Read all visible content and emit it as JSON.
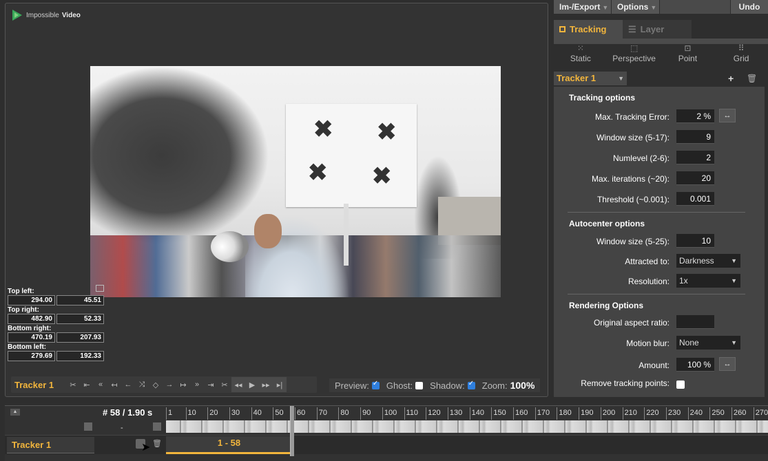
{
  "logo": {
    "brand_light": "Impossible",
    "brand_bold": "Video"
  },
  "video": {
    "marks": [
      "✖",
      "✖",
      "✖",
      "✖"
    ]
  },
  "corners": [
    {
      "label": "Top left:",
      "x": "294.00",
      "y": "45.51"
    },
    {
      "label": "Top right:",
      "x": "482.90",
      "y": "52.33"
    },
    {
      "label": "Bottom right:",
      "x": "470.19",
      "y": "207.93"
    },
    {
      "label": "Bottom left:",
      "x": "279.69",
      "y": "192.33"
    }
  ],
  "viewer_bar": {
    "tracker_name": "Tracker 1",
    "icons": [
      "scissors-icon",
      "first-frame-icon",
      "step-back-icon",
      "key-back-icon",
      "back-icon",
      "shuffle-icon",
      "keyframe-icon",
      "forward-icon",
      "key-forward-icon",
      "step-forward-icon",
      "last-frame-icon",
      "cut-icon"
    ],
    "preview_label": "Preview:",
    "ghost_label": "Ghost:",
    "shadow_label": "Shadow:",
    "zoom_label": "Zoom:",
    "zoom_value": "100%",
    "preview_on": true,
    "ghost_on": false,
    "shadow_on": true
  },
  "menu": {
    "import_export": "Im-/Export",
    "options": "Options",
    "undo": "Undo"
  },
  "tabs": {
    "tracking": "Tracking",
    "layer": "Layer"
  },
  "modes": [
    {
      "label": "Static",
      "icon": "static-icon"
    },
    {
      "label": "Perspective",
      "icon": "perspective-icon"
    },
    {
      "label": "Point",
      "icon": "point-icon"
    },
    {
      "label": "Grid",
      "icon": "grid-icon"
    }
  ],
  "tracker_select": "Tracker 1",
  "tracking_options": {
    "title": "Tracking options",
    "max_error_label": "Max. Tracking Error:",
    "max_error": "2 %",
    "window_label": "Window size (5-17):",
    "window": "9",
    "numlevel_label": "Numlevel (2-6):",
    "numlevel": "2",
    "iter_label": "Max. iterations (~20):",
    "iter": "20",
    "threshold_label": "Threshold (~0.001):",
    "threshold": "0.001"
  },
  "autocenter": {
    "title": "Autocenter options",
    "window_label": "Window size (5-25):",
    "window": "10",
    "attracted_label": "Attracted to:",
    "attracted": "Darkness",
    "resolution_label": "Resolution:",
    "resolution": "1x"
  },
  "rendering": {
    "title": "Rendering Options",
    "aspect_label": "Original aspect ratio:",
    "motion_label": "Motion blur:",
    "motion": "None",
    "amount_label": "Amount:",
    "amount": "100 %",
    "remove_label": "Remove tracking points:"
  },
  "timeline": {
    "frame": "# 58 / 1.90 s",
    "dash": "-",
    "ticks": [
      "1",
      "10",
      "20",
      "30",
      "40",
      "50",
      "60",
      "70",
      "80",
      "90",
      "100",
      "110",
      "120",
      "130",
      "140",
      "150",
      "160",
      "170",
      "180",
      "190",
      "200",
      "210",
      "220",
      "230",
      "240",
      "250",
      "260",
      "270"
    ],
    "track_name": "Tracker 1",
    "segment": "1 - 58"
  },
  "colors": {
    "accent": "#f2b53c",
    "checkbox": "#2f7fde"
  }
}
